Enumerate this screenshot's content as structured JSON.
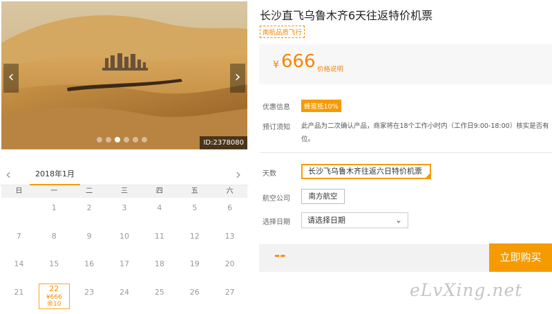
{
  "carousel": {
    "image_id": "ID:2378080",
    "prev_icon": "chevron-left-icon",
    "next_icon": "chevron-right-icon",
    "dot_count": 6,
    "active_dot": 2
  },
  "calendar": {
    "month_label": "2018年1月",
    "weekdays": [
      "日",
      "一",
      "二",
      "三",
      "四",
      "五",
      "六"
    ],
    "rows": [
      [
        "",
        "1",
        "2",
        "3",
        "4",
        "5",
        "6"
      ],
      [
        "7",
        "8",
        "9",
        "10",
        "11",
        "12",
        "13"
      ],
      [
        "14",
        "15",
        "16",
        "17",
        "18",
        "19",
        "20"
      ],
      [
        "21",
        "22",
        "23",
        "24",
        "25",
        "26",
        "27"
      ]
    ],
    "priced_day": {
      "day": "22",
      "price": "¥666",
      "stock": "余10"
    }
  },
  "product": {
    "title": "长沙直飞乌鲁木齐6天往返特价机票",
    "tag": "南航品质飞行",
    "currency": "¥",
    "price": "666",
    "price_note": "价格说明"
  },
  "info": {
    "discount_label": "优惠信息",
    "discount_badge": "蜂蜜抵10%",
    "notice_label": "预订须知",
    "notice_text": "此产品为二次确认产品，商家将在18个工作小时内（工作日9:00-18:00）核实是否有位。"
  },
  "options": {
    "days_label": "天数",
    "days_value": "长沙飞乌鲁木齐往返六日特价机票",
    "airline_label": "航空公司",
    "airline_value": "南方航空",
    "date_label": "选择日期",
    "date_placeholder": "请选择日期"
  },
  "purchase": {
    "total": "--",
    "buy_label": "立即购买"
  },
  "watermark": "eLvXing.net",
  "colors": {
    "accent": "#f59b00",
    "price": "#f58500"
  }
}
